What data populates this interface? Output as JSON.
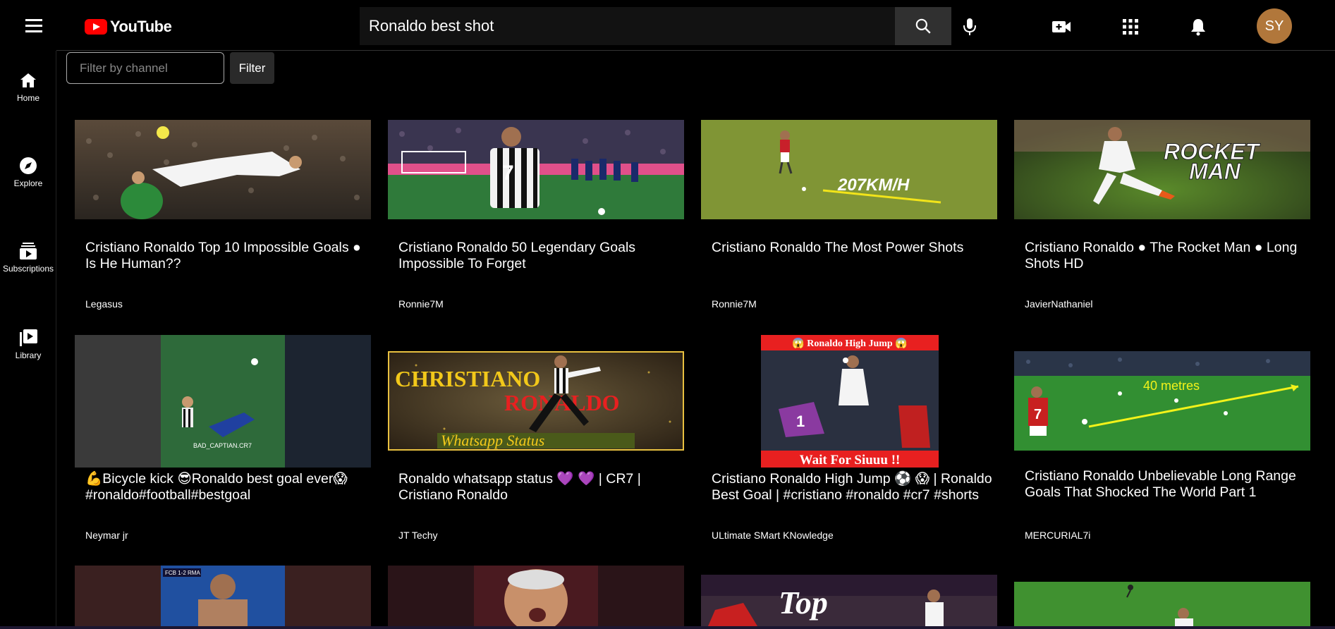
{
  "header": {
    "logo_text": "YouTube",
    "search_value": "Ronaldo best shot",
    "avatar_initials": "SY"
  },
  "sidebar": {
    "items": [
      {
        "label": "Home",
        "icon": "home-icon"
      },
      {
        "label": "Explore",
        "icon": "compass-icon"
      },
      {
        "label": "Subscriptions",
        "icon": "subscriptions-icon"
      },
      {
        "label": "Library",
        "icon": "library-icon"
      }
    ]
  },
  "filter": {
    "placeholder": "Filter by channel",
    "button_label": "Filter"
  },
  "videos": [
    {
      "title": "Cristiano Ronaldo Top 10 Impossible Goals ● Is He Human??",
      "channel": "Legasus"
    },
    {
      "title": "Cristiano Ronaldo 50 Legendary Goals Impossible To Forget",
      "channel": "Ronnie7M"
    },
    {
      "title": "Cristiano Ronaldo The Most Power Shots",
      "channel": "Ronnie7M",
      "thumb_text": "207KM/H"
    },
    {
      "title": "Cristiano Ronaldo ● The Rocket Man ● Long Shots HD",
      "channel": "JavierNathaniel",
      "thumb_text_1": "ROCKET",
      "thumb_text_2": "MAN"
    },
    {
      "title": "💪Bicycle kick 😎Ronaldo best goal ever😱 #ronaldo#football#bestgoal",
      "channel": "Neymar jr",
      "thumb_text": "BAD_CAPTIAN.CR7"
    },
    {
      "title": "Ronaldo whatsapp status 💜 💜 | CR7 | Cristiano Ronaldo",
      "channel": "JT Techy",
      "thumb_text_1": "CHRISTIANO",
      "thumb_text_2": "RONALDO",
      "thumb_text_3": "Whatsapp Status"
    },
    {
      "title": "Cristiano Ronaldo High Jump ⚽ 😱 | Ronaldo Best Goal | #cristiano #ronaldo #cr7 #shorts",
      "channel": "ULtimate SMart KNowledge",
      "thumb_text_1": "😱 Ronaldo High Jump 😱",
      "thumb_text_2": "Wait For Siuuu !!"
    },
    {
      "title": "Cristiano Ronaldo Unbelievable Long Range Goals That Shocked The World Part 1",
      "channel": "MERCURIAL7i",
      "thumb_text": "40 metres"
    },
    {
      "title": "",
      "channel": "",
      "thumb_text": "FCB 1-2 RMA"
    },
    {
      "title": "",
      "channel": ""
    },
    {
      "title": "",
      "channel": "",
      "thumb_text": "Top"
    },
    {
      "title": "",
      "channel": ""
    }
  ]
}
